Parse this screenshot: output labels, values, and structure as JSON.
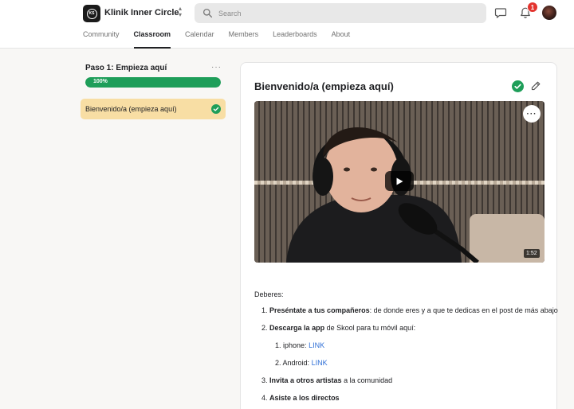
{
  "header": {
    "group_name": "Klinik Inner Circle",
    "logo_text": "KS",
    "search_placeholder": "Search",
    "notification_count": "1"
  },
  "tabs": [
    {
      "label": "Community",
      "active": false
    },
    {
      "label": "Classroom",
      "active": true
    },
    {
      "label": "Calendar",
      "active": false
    },
    {
      "label": "Members",
      "active": false
    },
    {
      "label": "Leaderboards",
      "active": false
    },
    {
      "label": "About",
      "active": false
    }
  ],
  "sidebar": {
    "module_title": "Paso 1: Empieza aquí",
    "more": "···",
    "progress_label": "100%",
    "progress_value": 1.0,
    "lessons": [
      {
        "label": "Bienvenido/a (empieza aquí)",
        "completed": true
      }
    ]
  },
  "lesson": {
    "title": "Bienvenido/a (empieza aquí)",
    "video_more": "···",
    "video_duration": "1:52",
    "intro": "Deberes:",
    "items": {
      "i1_num": "1.",
      "i1_bold": "Preséntate a tus compañeros",
      "i1_rest": ": de donde eres y a que te dedicas en el post de más abajo",
      "i2_num": "2.",
      "i2_bold": "Descarga la app",
      "i2_rest": " de Skool para tu móvil aquí:",
      "s1_num": "1.",
      "s1_text": "iphone: ",
      "s1_link": "LINK",
      "s2_num": "2.",
      "s2_text": "Android: ",
      "s2_link": "LINK",
      "i3_num": "3.",
      "i3_bold": "Invita a otros artistas",
      "i3_rest": " a la comunidad",
      "i4_num": "4.",
      "i4_bold": "Asiste a los directos"
    }
  },
  "colors": {
    "accent_green": "#1e9e59",
    "active_lesson_bg": "#f8dea4",
    "link_blue": "#2e6fd6",
    "badge_red": "#e3342f"
  }
}
